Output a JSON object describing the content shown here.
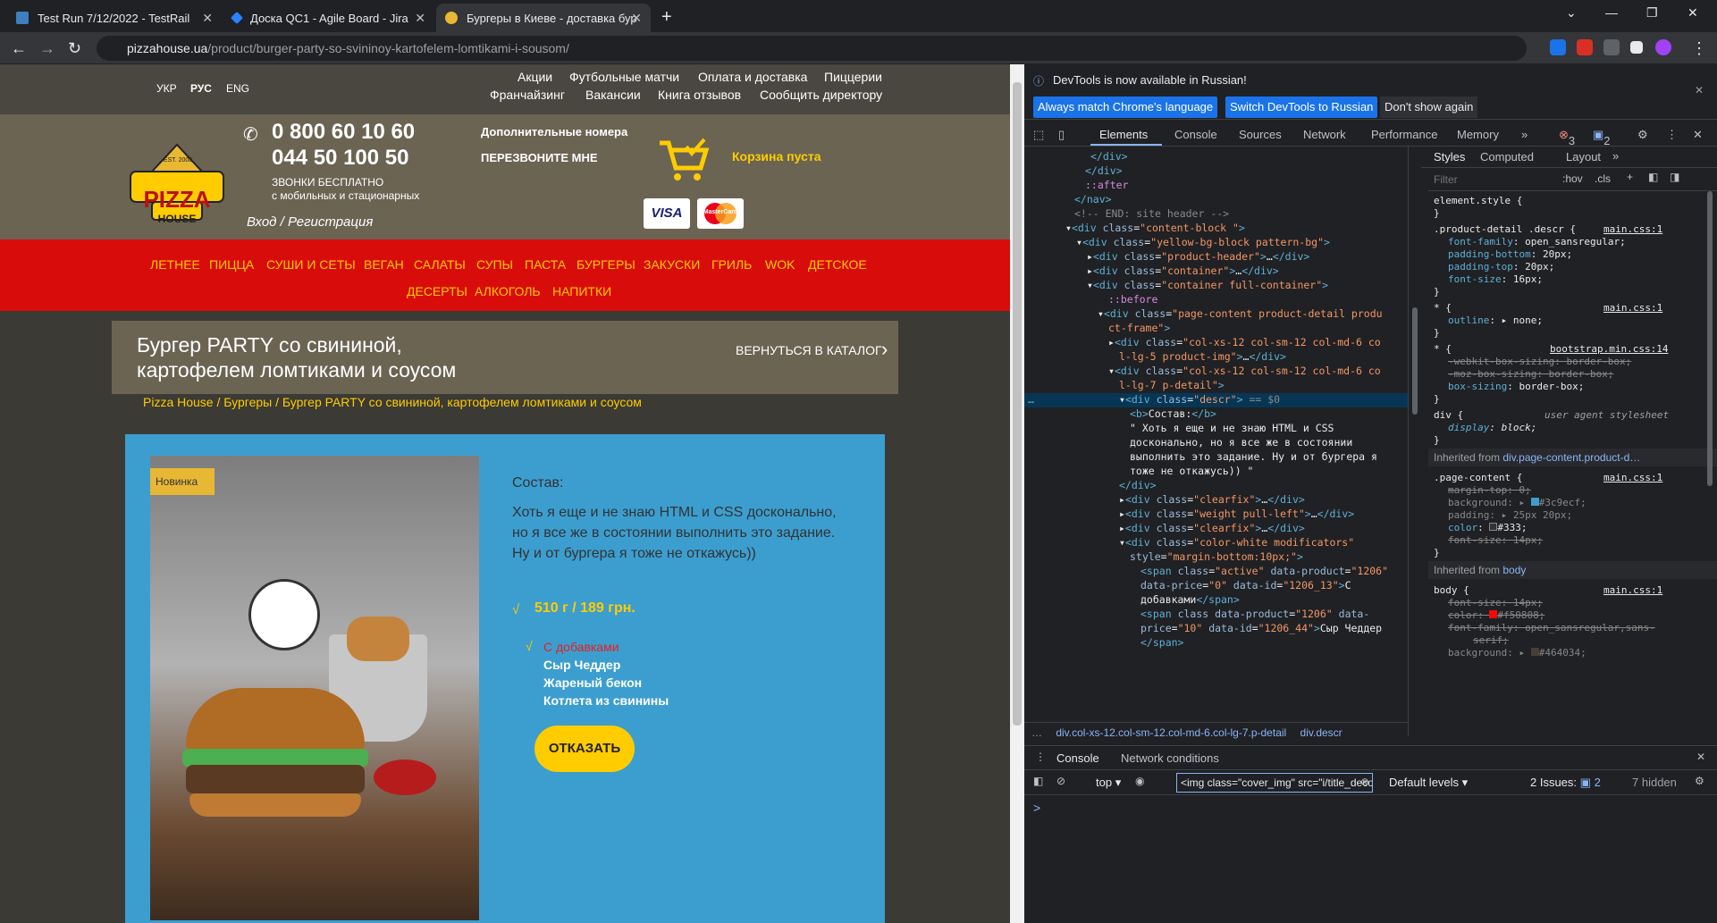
{
  "browser": {
    "tabs": [
      {
        "title": "Test Run 7/12/2022 - TestRail",
        "active": false
      },
      {
        "title": "Доска QC1 - Agile Board - Jira",
        "active": false
      },
      {
        "title": "Бургеры в Киеве - доставка бур",
        "active": true
      }
    ],
    "url_host": "pizzahouse.ua",
    "url_path": "/product/burger-party-so-svininoy-kartofelem-lomtikami-i-sousom/"
  },
  "site": {
    "langs": [
      "УКР",
      "РУС",
      "ENG"
    ],
    "top_menu_row1": [
      "Акции",
      "Футбольные матчи",
      "Оплата и доставка",
      "Пиццерии"
    ],
    "top_menu_row2": [
      "Франчайзинг",
      "Вакансии",
      "Книга отзывов",
      "Сообщить директору"
    ],
    "phone1": "0 800 60 10 60",
    "phone2": "044 50 100 50",
    "calls_free_line1": "ЗВОНКИ БЕСПЛАТНО",
    "calls_free_line2": "с мобильных и стационарных",
    "extra_numbers": "Дополнительные номера",
    "callback": "ПЕРЕЗВОНИТЕ МНЕ",
    "cart": "Корзина пуста",
    "login": "Вход / Регистрация",
    "visa": "VISA",
    "mastercard": "MasterCard",
    "logo_text": "PIZZA",
    "logo_sub": "HOUSE",
    "logo_est": "EST. 2008",
    "menu_row1": [
      "ЛЕТНЕЕ",
      "ПИЦЦА",
      "СУШИ И СЕТЫ",
      "ВЕГАН",
      "САЛАТЫ",
      "СУПЫ",
      "ПАСТА",
      "БУРГЕРЫ",
      "ЗАКУСКИ",
      "ГРИЛЬ",
      "WOK",
      "ДЕТСКОЕ"
    ],
    "menu_row2": [
      "ДЕСЕРТЫ",
      "АЛКОГОЛЬ",
      "НАПИТКИ"
    ],
    "product_title_l1": "Бургер PARTY со свининой,",
    "product_title_l2": "картофелем ломтиками и соусом",
    "back_to_catalog": "ВЕРНУТЬСЯ В КАТАЛОГ",
    "breadcrumb": "Pizza House / Бургеры / Бургер PARTY со свининой, картофелем ломтиками и соусом",
    "badge_new": "Новинка",
    "composition_label": "Состав:",
    "composition_text_l1": "Хоть я еще и не знаю HTML и CSS досконально,",
    "composition_text_l2": "но я все же в состоянии выполнить это задание.",
    "composition_text_l3": "Ну и от бургера я тоже не откажусь))",
    "weight_price": "510 г / 189 грн.",
    "modifiers": [
      "С добавками",
      "Сыр Чеддер",
      "Жареный бекон",
      "Котлета из свинины"
    ],
    "order_button": "ОТКАЗАТЬ",
    "check": "√"
  },
  "devtools": {
    "info": "DevTools is now available in Russian!",
    "btn_match": "Always match Chrome's language",
    "btn_switch": "Switch DevTools to Russian",
    "btn_dont": "Don't show again",
    "tabs": [
      "Elements",
      "Console",
      "Sources",
      "Network",
      "Performance",
      "Memory"
    ],
    "errors": "3",
    "messages": "2",
    "styles_tabs": [
      "Styles",
      "Computed",
      "Layout"
    ],
    "filter_placeholder": "Filter",
    "hov": ":hov",
    "cls": ".cls",
    "dom_breadcrumb1": "div.col-xs-12.col-sm-12.col-md-6.col-lg-7.p-detail",
    "dom_breadcrumb2": "div.descr",
    "console_tab": "Console",
    "network_conditions": "Network conditions",
    "context": "top",
    "console_filter": "<img class=\"cover_img\" src=\"i/title_decor.",
    "default_levels": "Default levels",
    "issues": "2 Issues:",
    "issues_count": "2",
    "hidden": "7 hidden",
    "prompt": ">"
  }
}
